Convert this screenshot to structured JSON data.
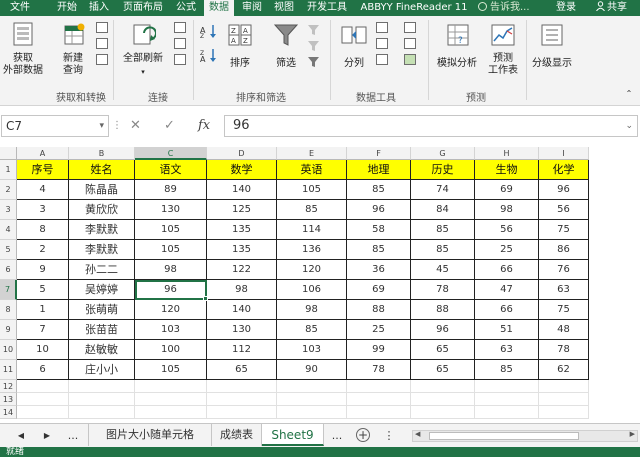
{
  "ribbon_tabs": [
    "文件",
    "开始",
    "插入",
    "页面布局",
    "公式",
    "数据",
    "审阅",
    "视图",
    "开发工具",
    "ABBYY FineReader 11"
  ],
  "active_tab": "数据",
  "tell_me": "告诉我...",
  "login": "登录",
  "share": "共享",
  "ribbon": {
    "get_external_line1": "获取",
    "get_external_line2": "外部数据",
    "new_query_line1": "新建",
    "new_query_line2": "查询",
    "refresh_all": "全部刷新",
    "sort": "排序",
    "filter": "筛选",
    "split": "分列",
    "what_if": "模拟分析",
    "forecast_line1": "预测",
    "forecast_line2": "工作表",
    "outline": "分级显示",
    "groups": [
      "获取和转换",
      "连接",
      "排序和筛选",
      "数据工具",
      "预测"
    ]
  },
  "formula_bar": {
    "name_box": "C7",
    "cancel": "✕",
    "enter": "✓",
    "fx": "fx",
    "value": "96"
  },
  "grid": {
    "columns": [
      "A",
      "B",
      "C",
      "D",
      "E",
      "F",
      "G",
      "H",
      "I"
    ],
    "rows": [
      "1",
      "2",
      "3",
      "4",
      "5",
      "6",
      "7",
      "8",
      "9",
      "10",
      "11",
      "12",
      "13",
      "14"
    ],
    "header": [
      "序号",
      "姓名",
      "语文",
      "数学",
      "英语",
      "地理",
      "历史",
      "生物",
      "化学"
    ],
    "data": [
      [
        "4",
        "陈晶晶",
        "89",
        "140",
        "105",
        "85",
        "74",
        "69",
        "96"
      ],
      [
        "3",
        "黄欣欣",
        "130",
        "125",
        "85",
        "96",
        "84",
        "98",
        "56"
      ],
      [
        "8",
        "李默默",
        "105",
        "135",
        "114",
        "58",
        "85",
        "56",
        "75"
      ],
      [
        "2",
        "李默默",
        "105",
        "135",
        "136",
        "85",
        "85",
        "25",
        "86"
      ],
      [
        "9",
        "孙二二",
        "98",
        "122",
        "120",
        "36",
        "45",
        "66",
        "76"
      ],
      [
        "5",
        "吴婷婷",
        "96",
        "98",
        "106",
        "69",
        "78",
        "47",
        "63"
      ],
      [
        "1",
        "张萌萌",
        "120",
        "140",
        "98",
        "88",
        "88",
        "66",
        "75"
      ],
      [
        "7",
        "张苗苗",
        "103",
        "130",
        "85",
        "25",
        "96",
        "51",
        "48"
      ],
      [
        "10",
        "赵敏敏",
        "100",
        "112",
        "103",
        "99",
        "65",
        "63",
        "78"
      ],
      [
        "6",
        "庄小小",
        "105",
        "65",
        "90",
        "78",
        "65",
        "85",
        "62"
      ]
    ]
  },
  "sheet_tabs": [
    "图片大小随单元格",
    "成绩表",
    "Sheet9"
  ],
  "active_sheet": "Sheet9",
  "ellipsis": "...",
  "status": "就绪"
}
